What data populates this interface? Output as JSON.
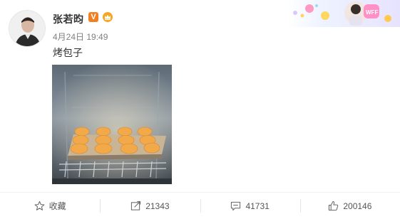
{
  "post": {
    "username": "张若昀",
    "verified_badge": "V",
    "timestamp": "4月24日 19:49",
    "text": "烤包子"
  },
  "actions": {
    "favorite_label": "收藏",
    "share_count": "21343",
    "comment_count": "41731",
    "like_count": "200146"
  },
  "colors": {
    "badge_orange": "#f08023",
    "text_primary": "#333333",
    "text_meta": "#808080"
  },
  "icons": [
    "star-icon",
    "share-icon",
    "comment-icon",
    "like-icon",
    "crown-icon"
  ]
}
